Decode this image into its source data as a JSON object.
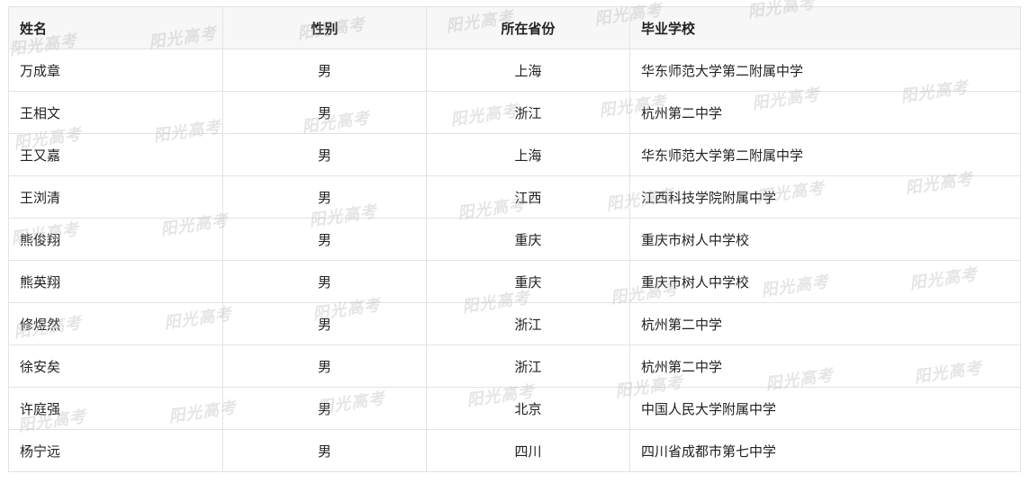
{
  "table": {
    "headers": {
      "name": "姓名",
      "gender": "性别",
      "province": "所在省份",
      "school": "毕业学校"
    },
    "rows": [
      {
        "name": "万成章",
        "gender": "男",
        "province": "上海",
        "school": "华东师范大学第二附属中学"
      },
      {
        "name": "王相文",
        "gender": "男",
        "province": "浙江",
        "school": "杭州第二中学"
      },
      {
        "name": "王又嘉",
        "gender": "男",
        "province": "上海",
        "school": "华东师范大学第二附属中学"
      },
      {
        "name": "王浏清",
        "gender": "男",
        "province": "江西",
        "school": "江西科技学院附属中学"
      },
      {
        "name": "熊俊翔",
        "gender": "男",
        "province": "重庆",
        "school": "重庆市树人中学校"
      },
      {
        "name": "熊英翔",
        "gender": "男",
        "province": "重庆",
        "school": "重庆市树人中学校"
      },
      {
        "name": "修煜然",
        "gender": "男",
        "province": "浙江",
        "school": "杭州第二中学"
      },
      {
        "name": "徐安矣",
        "gender": "男",
        "province": "浙江",
        "school": "杭州第二中学"
      },
      {
        "name": "许庭强",
        "gender": "男",
        "province": "北京",
        "school": "中国人民大学附属中学"
      },
      {
        "name": "杨宁远",
        "gender": "男",
        "province": "四川",
        "school": "四川省成都市第七中学"
      }
    ]
  },
  "watermark": {
    "text": "阳光高考"
  }
}
